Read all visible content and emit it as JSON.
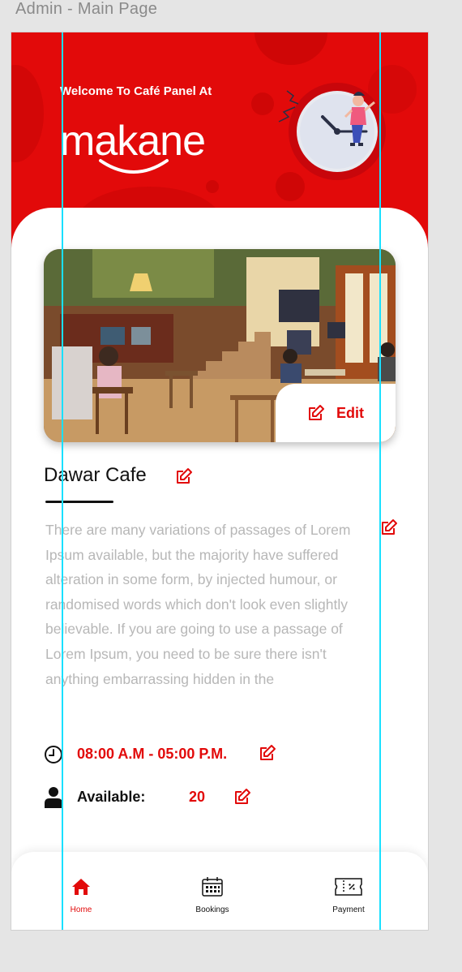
{
  "frame": {
    "title": "Admin - Main Page"
  },
  "header": {
    "welcome_text": "Welcome To Café Panel At",
    "logo_text": "makane"
  },
  "cafe": {
    "name": "Dawar Cafe",
    "photo_edit_label": "Edit",
    "description": "There are many variations of passages of Lorem Ipsum available, but the majority have suffered alteration in some form, by injected humour, or randomised words which don't look even slightly believable. If you are going to use a passage of Lorem Ipsum, you need to be sure there isn't anything embarrassing hidden in the",
    "hours": "08:00 A.M - 05:00 P.M.",
    "available_label": "Available:",
    "available_count": "20"
  },
  "tabbar": {
    "items": [
      {
        "label": "Home",
        "icon": "home-icon",
        "active": true
      },
      {
        "label": "Bookings",
        "icon": "calendar-icon",
        "active": false
      },
      {
        "label": "Payment",
        "icon": "ticket-icon",
        "active": false
      }
    ]
  },
  "colors": {
    "accent": "#e20a0a",
    "text": "#111111",
    "muted_text": "#b7b7b7",
    "guide": "#19e0ff"
  }
}
